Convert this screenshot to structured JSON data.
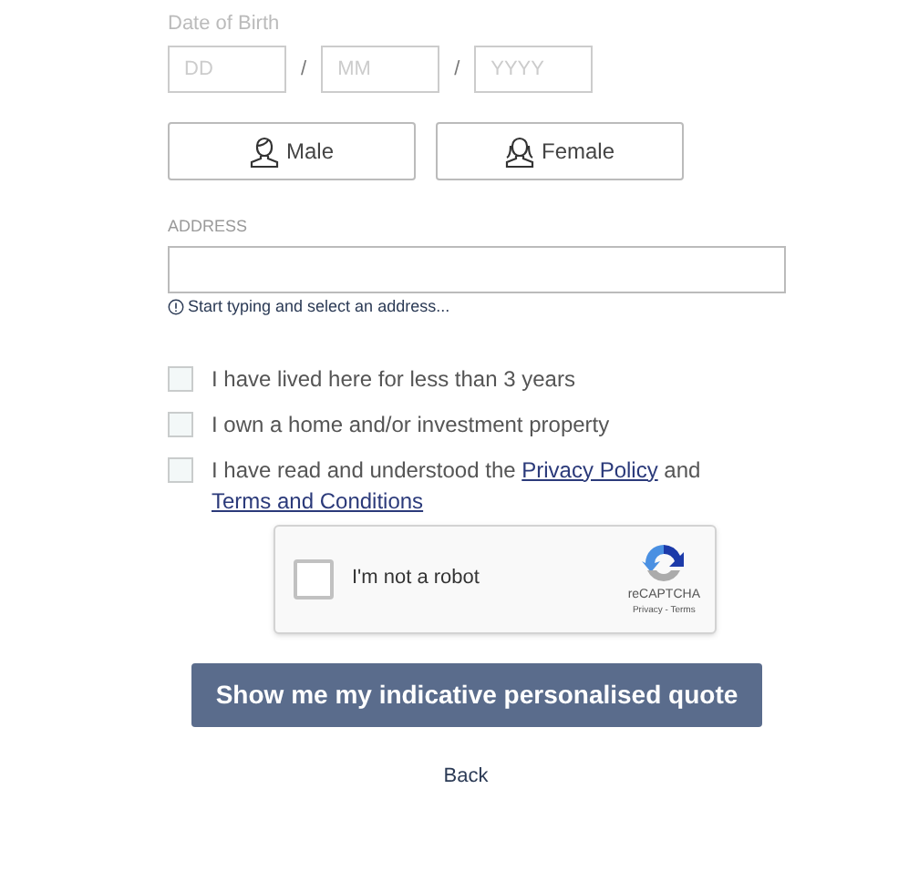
{
  "date_of_birth": {
    "label": "Date of Birth",
    "fields": [
      {
        "placeholder": "DD"
      },
      {
        "placeholder": "MM"
      },
      {
        "placeholder": "YYYY"
      }
    ],
    "separator": "/"
  },
  "gender": [
    {
      "label": "Male",
      "kind": "male",
      "selected": false
    },
    {
      "label": "Female",
      "kind": "female",
      "selected": false
    }
  ],
  "address": {
    "label": "ADDRESS",
    "hint": "Start typing and select an address..."
  },
  "checkboxes": [
    {
      "text": "I have lived here for less than 3 years",
      "checked": false
    },
    {
      "text": "I own a home and/or investment property",
      "checked": false
    },
    {
      "text": "I have read and understood the ",
      "links": [
        "Privacy Policy",
        "Terms and Conditions"
      ],
      "joiner": " and ",
      "checked": false
    }
  ],
  "captcha": {
    "label": "I'm not a robot",
    "checked": false,
    "brand": "reCAPTCHA",
    "footer": "Privacy - Terms"
  },
  "submit": "Show me my indicative personalised quote",
  "back": "Back"
}
